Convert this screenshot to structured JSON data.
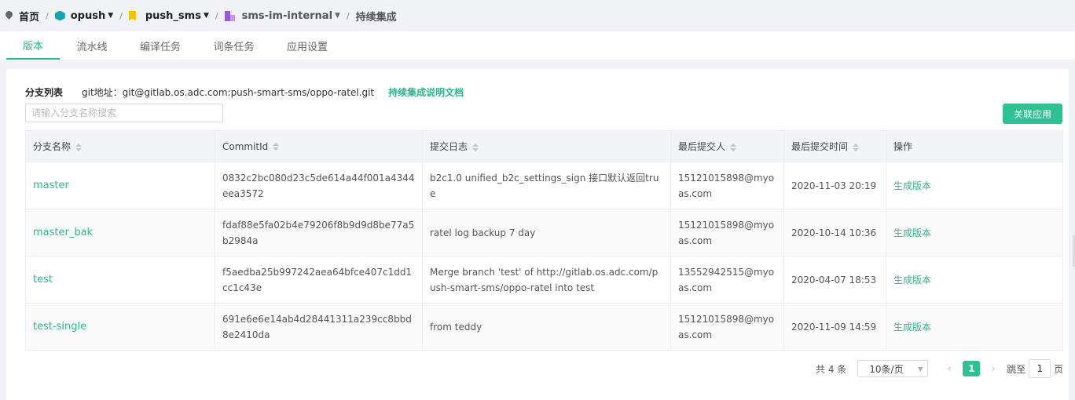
{
  "breadcrumb": {
    "home": "首页",
    "project": "opush",
    "group": "push_sms",
    "app": "sms-im-internal",
    "current": "持续集成"
  },
  "tabs": [
    {
      "label": "版本",
      "active": true
    },
    {
      "label": "流水线",
      "active": false
    },
    {
      "label": "编译任务",
      "active": false
    },
    {
      "label": "词条任务",
      "active": false
    },
    {
      "label": "应用设置",
      "active": false
    }
  ],
  "info": {
    "title": "分支列表",
    "git": "git地址：git@gitlab.os.adc.com:push-smart-sms/oppo-ratel.git",
    "doc_link": "持续集成说明文档"
  },
  "search": {
    "placeholder": "请输入分支名称搜索",
    "value": ""
  },
  "link_button": "关联应用",
  "table": {
    "headers": [
      "分支名称",
      "CommitId",
      "提交日志",
      "最后提交人",
      "最后提交时间",
      "操作"
    ],
    "rows": [
      {
        "branch": "master",
        "commit": "0832c2bc080d23c5de614a44f001a4344eea3572",
        "log": "b2c1.0 unified_b2c_settings_sign 接口默认返回true",
        "author": "15121015898@myoas.com",
        "time": "2020-11-03 20:19",
        "action": "生成版本"
      },
      {
        "branch": "master_bak",
        "commit": "fdaf88e5fa02b4e79206f8b9d9d8be77a5b2984a",
        "log": "ratel log backup 7 day",
        "author": "15121015898@myoas.com",
        "time": "2020-10-14 10:36",
        "action": "生成版本"
      },
      {
        "branch": "test",
        "commit": "f5aedba25b997242aea64bfce407c1dd1cc1c43e",
        "log": "Merge branch 'test' of http://gitlab.os.adc.com/push-smart-sms/oppo-ratel into test",
        "author": "13552942515@myoas.com",
        "time": "2020-04-07 18:53",
        "action": "生成版本"
      },
      {
        "branch": "test-single",
        "commit": "691e6e6e14ab4d28441311a239cc8bbd8e2410da",
        "log": "from teddy",
        "author": "15121015898@myoas.com",
        "time": "2020-11-09 14:59",
        "action": "生成版本"
      }
    ]
  },
  "pagination": {
    "total": "共 4 条",
    "page_size": "10条/页",
    "prev": "‹",
    "current": "1",
    "next": "›",
    "jump_prefix": "跳至",
    "jump_value": "1",
    "jump_suffix": "页"
  },
  "colors": {
    "accent": "#2fb78b",
    "button": "#2fc192"
  }
}
